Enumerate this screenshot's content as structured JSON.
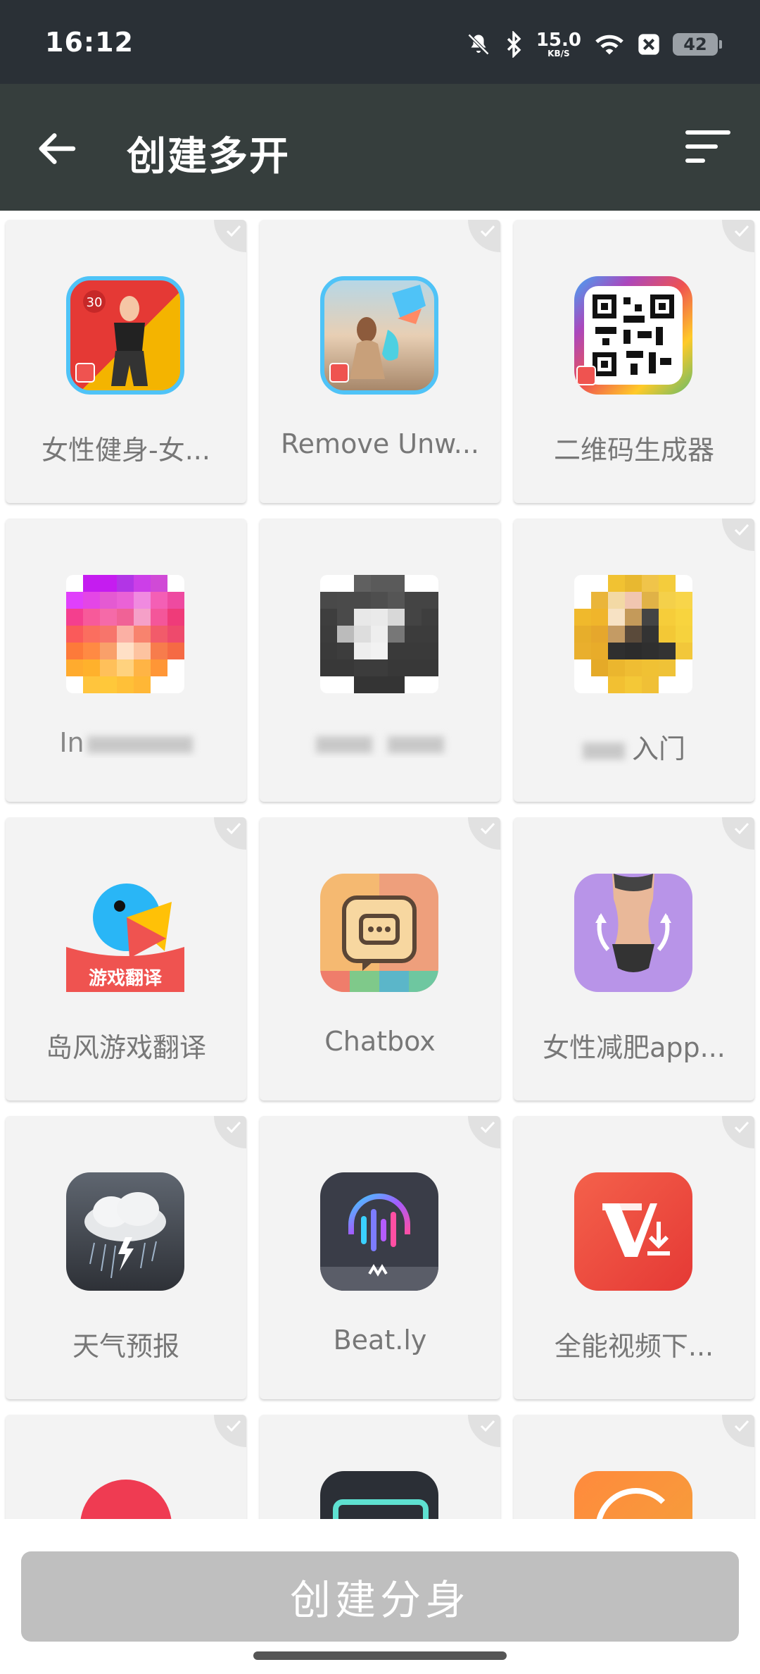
{
  "status_bar": {
    "time": "16:12",
    "net_speed": "15.0",
    "net_unit": "KB/S",
    "battery": "42"
  },
  "app_bar": {
    "title": "创建多开"
  },
  "apps": [
    {
      "label": "女性健身-女..."
    },
    {
      "label": "Remove Unw..."
    },
    {
      "label": "二维码生成器"
    },
    {
      "label": "In"
    },
    {
      "label": ""
    },
    {
      "label": "入门"
    },
    {
      "label": "岛风游戏翻译",
      "icon_text": "游戏翻译"
    },
    {
      "label": "Chatbox"
    },
    {
      "label": "女性减肥app..."
    },
    {
      "label": "天气预报"
    },
    {
      "label": "Beat.ly"
    },
    {
      "label": "全能视频下..."
    },
    {
      "label": ""
    },
    {
      "label": ""
    },
    {
      "label": ""
    }
  ],
  "bottom": {
    "create_button": "创建分身"
  },
  "colors": {
    "status_bar": "#2a3036",
    "app_bar": "#363e3d",
    "card": "#f3f3f3",
    "button": "#bfbfbf"
  }
}
